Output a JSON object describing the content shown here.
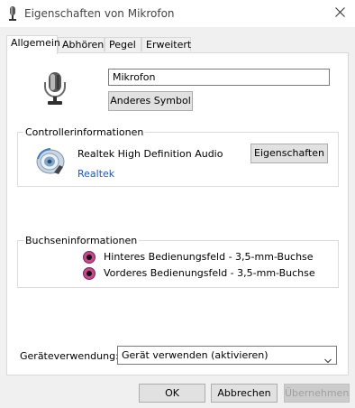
{
  "window": {
    "title": "Eigenschaften von Mikrofon"
  },
  "tabs": [
    {
      "label": "Allgemein",
      "active": true
    },
    {
      "label": "Abhören",
      "active": false
    },
    {
      "label": "Pegel",
      "active": false
    },
    {
      "label": "Erweitert",
      "active": false
    }
  ],
  "general": {
    "device_name": "Mikrofon",
    "change_icon_label": "Anderes Symbol"
  },
  "controller": {
    "group_label": "Controllerinformationen",
    "name": "Realtek High Definition Audio",
    "vendor_link": "Realtek",
    "properties_label": "Eigenschaften"
  },
  "bus": {
    "group_label": "Buchseninformationen",
    "jacks": [
      {
        "label": "Hinteres Bedienungsfeld - 3,5-mm-Buchse",
        "color": "#c8478d"
      },
      {
        "label": "Vorderes Bedienungsfeld - 3,5-mm-Buchse",
        "color": "#c8478d"
      }
    ]
  },
  "usage": {
    "label": "Geräteverwendung:",
    "selected": "Gerät verwenden (aktivieren)"
  },
  "footer": {
    "ok": "OK",
    "cancel": "Abbrechen",
    "apply": "Übernehmen"
  },
  "icons": [
    "microphone-small-icon",
    "close-icon",
    "microphone-icon",
    "audio-device-icon",
    "chevron-down-icon"
  ]
}
